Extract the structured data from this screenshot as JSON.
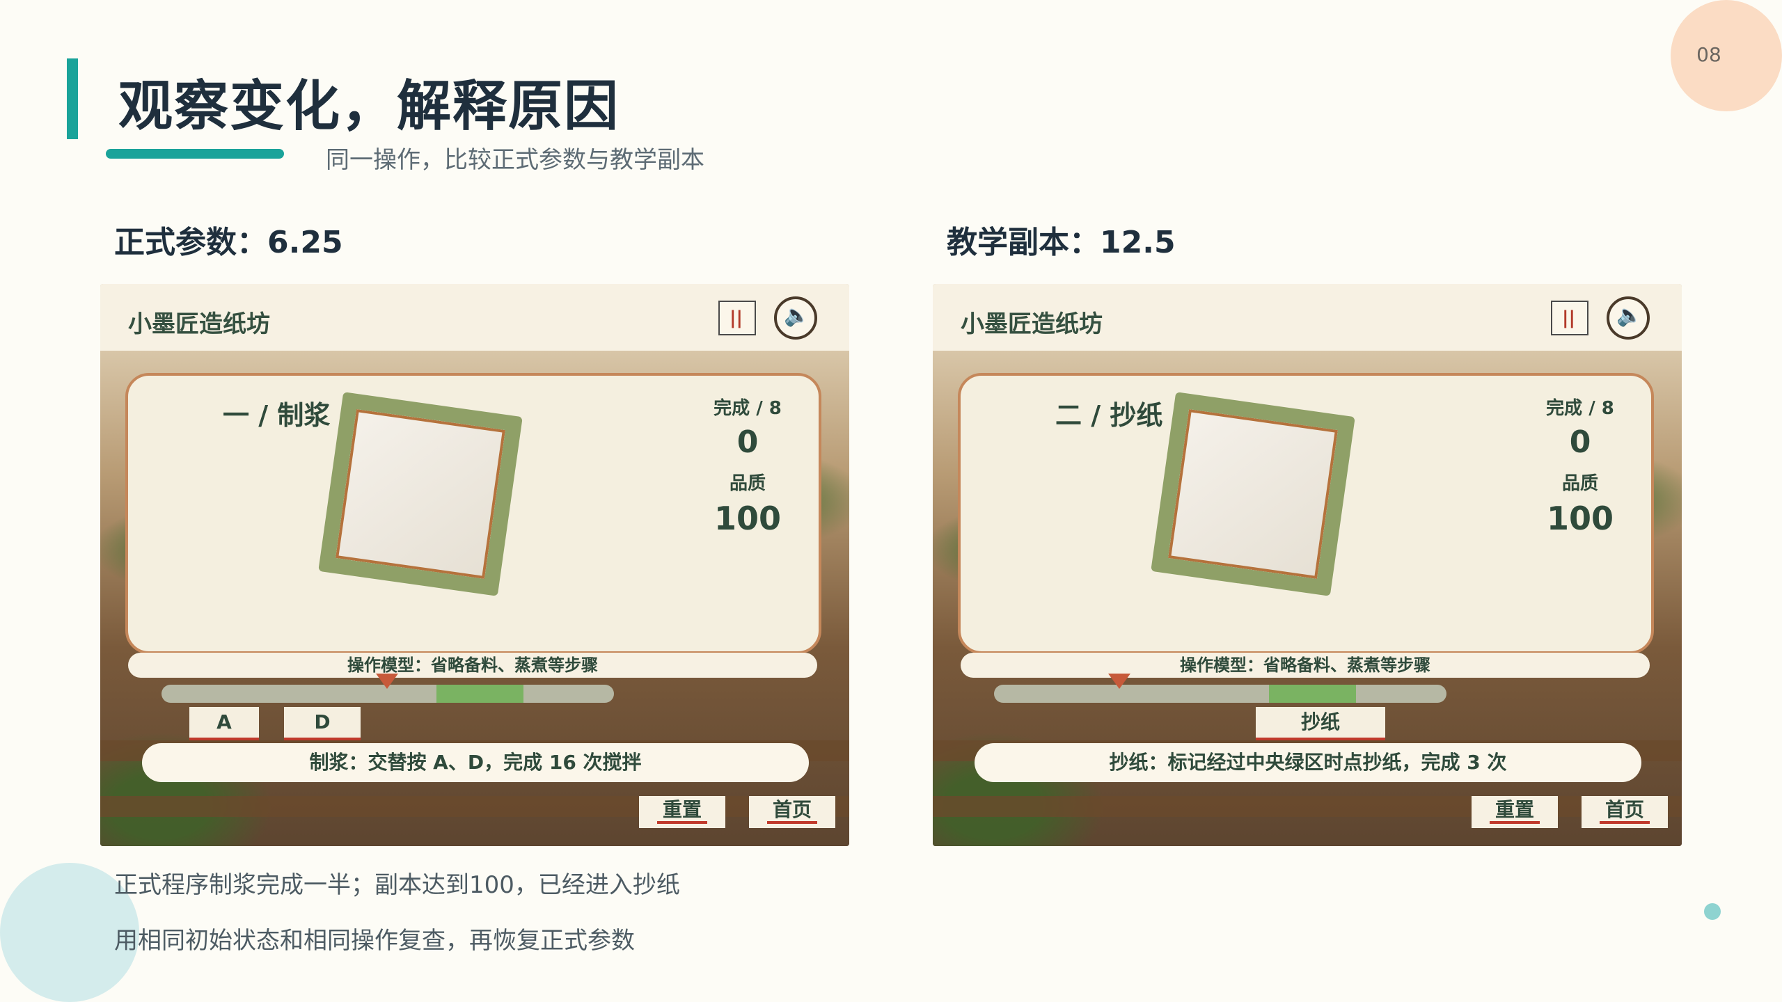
{
  "slide": {
    "title": "观察变化，解释原因",
    "subtitle": "同一操作，比较正式参数与教学副本",
    "page_number": "08"
  },
  "left": {
    "heading": "正式参数：6.25",
    "game": {
      "title": "小墨匠造纸坊",
      "pause_glyph": "||",
      "sound_glyph": "🔈",
      "stage": "一 / 制浆",
      "progress_label": "完成 / 8",
      "progress_value": "0",
      "quality_label": "品质",
      "quality_value": "100",
      "model_text": "操作模型：省略备料、蒸煮等步骤",
      "keys": [
        "A",
        "D"
      ],
      "instruction": "制浆：交替按 A、D，完成 16 次搅拌",
      "reset_label": "重置",
      "home_label": "首页"
    }
  },
  "right": {
    "heading": "教学副本：12.5",
    "game": {
      "title": "小墨匠造纸坊",
      "pause_glyph": "||",
      "sound_glyph": "🔈",
      "stage": "二 / 抄纸",
      "progress_label": "完成 / 8",
      "progress_value": "0",
      "quality_label": "品质",
      "quality_value": "100",
      "model_text": "操作模型：省略备料、蒸煮等步骤",
      "action_button": "抄纸",
      "instruction": "抄纸：标记经过中央绿区时点抄纸，完成 3 次",
      "reset_label": "重置",
      "home_label": "首页"
    }
  },
  "notes": [
    "正式程序制浆完成一半；副本达到100，已经进入抄纸",
    "用相同初始状态和相同操作复查，再恢复正式参数"
  ]
}
